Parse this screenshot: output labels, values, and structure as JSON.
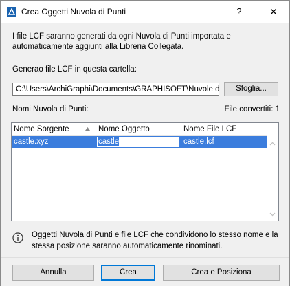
{
  "window": {
    "title": "Crea Oggetti Nuvola di Punti",
    "help_label": "?",
    "close_label": "✕"
  },
  "intro_text": "I file LCF saranno generati da ogni Nuvola di Punti importata e automaticamente aggiunti alla Libreria Collegata.",
  "folder": {
    "label": "Generao file LCF in questa cartella:",
    "path": "C:\\Users\\ArchiGraphi\\Documents\\GRAPHISOFT\\Nuvole di F",
    "browse_label": "Sfoglia..."
  },
  "list": {
    "label": "Nomi Nuvola di Punti:",
    "converted": "File convertiti: 1",
    "columns": [
      "Nome Sorgente",
      "Nome Oggetto",
      "Nome File LCF"
    ],
    "rows": [
      {
        "source": "castle.xyz",
        "object": "castle",
        "lcf": "castle.lcf"
      }
    ]
  },
  "info_text": "Oggetti Nuvola di Punti e file LCF che condividono lo stesso nome e la stessa posizione saranno automaticamente rinominati.",
  "buttons": {
    "cancel": "Annulla",
    "create": "Crea",
    "create_position": "Crea e Posiziona"
  },
  "colors": {
    "selection": "#3b7ddd",
    "default_button_border": "#0078d7"
  }
}
